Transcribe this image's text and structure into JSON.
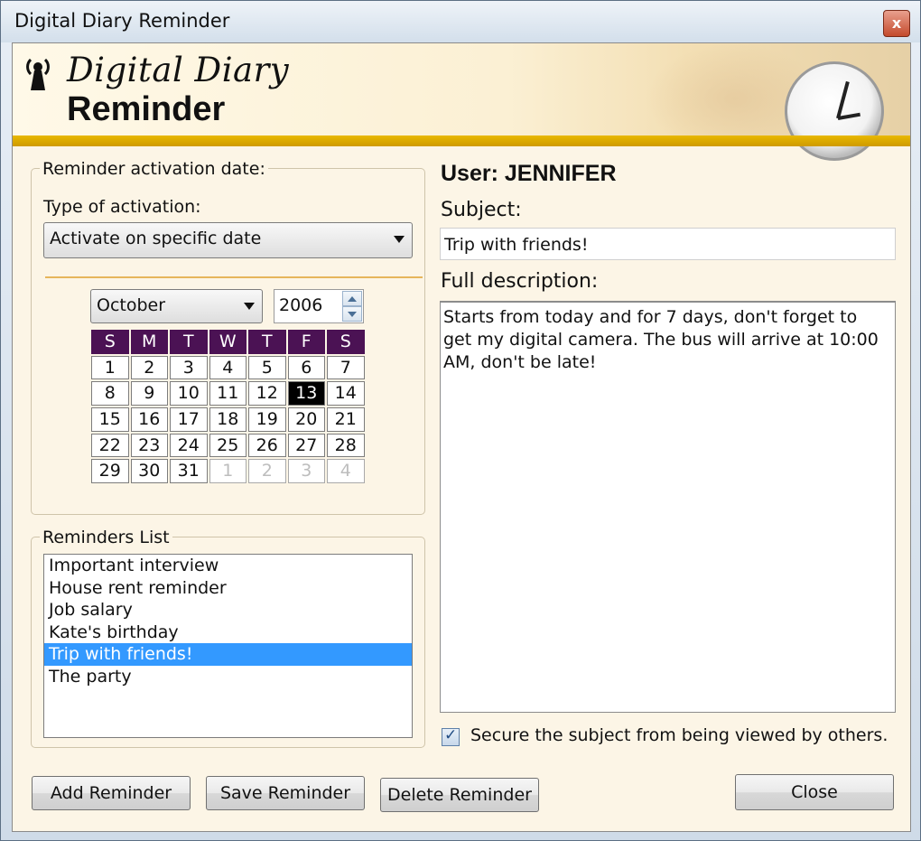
{
  "window": {
    "title": "Digital Diary Reminder",
    "close_glyph": "x"
  },
  "banner": {
    "word1": "Digital Diary",
    "word2": "Reminder"
  },
  "activation": {
    "group_label": "Reminder activation date:",
    "type_label": "Type of activation:",
    "type_value": "Activate on specific date",
    "month": "October",
    "year": "2006"
  },
  "calendar": {
    "day_headers": [
      "S",
      "M",
      "T",
      "W",
      "T",
      "F",
      "S"
    ],
    "days": [
      "1",
      "2",
      "3",
      "4",
      "5",
      "6",
      "7",
      "8",
      "9",
      "10",
      "11",
      "12",
      "13",
      "14",
      "15",
      "16",
      "17",
      "18",
      "19",
      "20",
      "21",
      "22",
      "23",
      "24",
      "25",
      "26",
      "27",
      "28",
      "29",
      "30",
      "31",
      "1",
      "2",
      "3",
      "4"
    ],
    "selected_day": "13",
    "trailing_next_month_count": 4
  },
  "reminders": {
    "group_label": "Reminders List",
    "items": [
      "Important interview",
      "House rent reminder",
      "Job salary",
      "Kate's birthday",
      "Trip with friends!",
      "The party"
    ],
    "selected_index": 4
  },
  "details": {
    "user_line": "User: JENNIFER",
    "subject_label": "Subject:",
    "subject_value": "Trip with friends!",
    "description_label": "Full description:",
    "description_value": "Starts from today and for 7 days, don't forget to get my digital camera. The bus will arrive at 10:00 AM, don't be late!",
    "secure_label": "Secure the subject from being viewed by others.",
    "secure_checked": true
  },
  "buttons": {
    "add": "Add Reminder",
    "save": "Save Reminder",
    "delete": "Delete Reminder",
    "close": "Close"
  },
  "colors": {
    "calendar_header": "#4b1254",
    "selection": "#3399ff",
    "banner_strip": "#e0ad00",
    "client_bg": "#fcf5e6"
  }
}
